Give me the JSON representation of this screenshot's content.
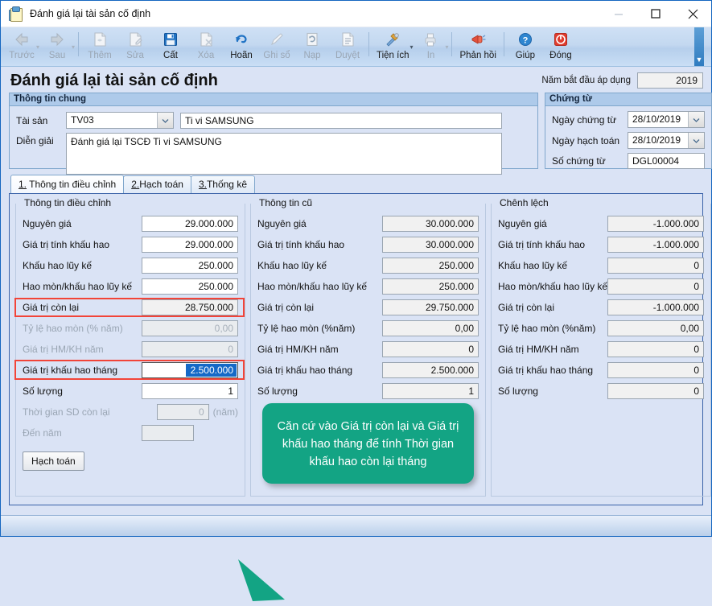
{
  "window": {
    "title": "Đánh giá lại tài sản cố định",
    "icon": "clipboard-icon",
    "minimize": "–",
    "maximize": "□",
    "close": "✕"
  },
  "toolbar": {
    "items": [
      {
        "label": "Trước",
        "icon": "arrow-left-icon",
        "disabled": true,
        "caret": true
      },
      {
        "label": "Sau",
        "icon": "arrow-right-icon",
        "disabled": true,
        "caret": true
      },
      {
        "label": "Thêm",
        "icon": "add-document-icon",
        "disabled": true,
        "caret": false
      },
      {
        "label": "Sửa",
        "icon": "edit-document-icon",
        "disabled": true,
        "caret": false
      },
      {
        "label": "Cất",
        "icon": "save-floppy-icon",
        "disabled": false,
        "caret": false
      },
      {
        "label": "Xóa",
        "icon": "delete-document-icon",
        "disabled": true,
        "caret": false
      },
      {
        "label": "Hoãn",
        "icon": "undo-arrow-icon",
        "disabled": false,
        "caret": false
      },
      {
        "label": "Ghi sổ",
        "icon": "pencil-icon",
        "disabled": true,
        "caret": false
      },
      {
        "label": "Nạp",
        "icon": "refresh-icon",
        "disabled": true,
        "caret": false
      },
      {
        "label": "Duyệt",
        "icon": "approve-list-icon",
        "disabled": true,
        "caret": false
      },
      {
        "label": "Tiện ích",
        "icon": "tools-icon",
        "disabled": false,
        "caret": true
      },
      {
        "label": "In",
        "icon": "printer-icon",
        "disabled": true,
        "caret": true
      },
      {
        "label": "Phản hồi",
        "icon": "megaphone-icon",
        "disabled": false,
        "caret": false
      },
      {
        "label": "Giúp",
        "icon": "help-question-icon",
        "disabled": false,
        "caret": false
      },
      {
        "label": "Đóng",
        "icon": "power-close-icon",
        "disabled": false,
        "caret": false
      }
    ]
  },
  "header": {
    "page_title": "Đánh giá lại tài sản cố định",
    "year_label": "Năm bắt đầu áp dụng",
    "year_value": "2019"
  },
  "general": {
    "title": "Thông tin chung",
    "asset_label": "Tài sản",
    "asset_code": "TV03",
    "asset_name": "Ti vi SAMSUNG",
    "note_label": "Diễn giải",
    "note_value": "Đánh giá lại TSCĐ Ti vi SAMSUNG"
  },
  "voucher": {
    "title": "Chứng từ",
    "rows": [
      {
        "label": "Ngày chứng từ",
        "value": "28/10/2019",
        "type": "date"
      },
      {
        "label": "Ngày hạch toán",
        "value": "28/10/2019",
        "type": "date"
      },
      {
        "label": "Số chứng từ",
        "value": "DGL00004",
        "type": "text"
      }
    ]
  },
  "tabs": [
    {
      "num": "1.",
      "label": " Thông tin điều chỉnh",
      "active": true
    },
    {
      "num": "2.",
      "label": "Hạch toán",
      "active": false
    },
    {
      "num": "3.",
      "label": "Thống kê",
      "active": false
    }
  ],
  "columns": {
    "adjusted": {
      "legend": "Thông tin điều chỉnh",
      "rows": [
        {
          "label": "Nguyên giá",
          "value": "29.000.000",
          "state": "edit"
        },
        {
          "label": "Giá trị tính khấu hao",
          "value": "29.000.000",
          "state": "edit"
        },
        {
          "label": "Khấu hao lũy kế",
          "value": "250.000",
          "state": "edit"
        },
        {
          "label": "Hao mòn/khấu hao lũy kế",
          "value": "250.000",
          "state": "edit"
        },
        {
          "label": "Giá trị còn lại",
          "value": "28.750.000",
          "state": "readonly",
          "highlight": true
        },
        {
          "label": "Tỷ lệ hao mòn (% năm)",
          "value": "0,00",
          "state": "disabled"
        },
        {
          "label": "Giá trị HM/KH năm",
          "value": "0",
          "state": "disabled"
        },
        {
          "label": "Giá trị khấu hao tháng",
          "value": "2.500.000",
          "state": "selected",
          "highlight": true
        },
        {
          "label": "Số lượng",
          "value": "1",
          "state": "edit"
        },
        {
          "label": "Thời gian SD còn lại",
          "value": "0",
          "state": "disabled",
          "unit": "(năm)"
        },
        {
          "label": "Đến năm",
          "value": "",
          "state": "disabled"
        }
      ],
      "button": "Hạch toán"
    },
    "old": {
      "legend": "Thông tin cũ",
      "rows": [
        {
          "label": "Nguyên giá",
          "value": "30.000.000"
        },
        {
          "label": "Giá trị tính khấu hao",
          "value": "30.000.000"
        },
        {
          "label": "Khấu hao lũy kế",
          "value": "250.000"
        },
        {
          "label": "Hao mòn/khấu hao lũy kế",
          "value": "250.000"
        },
        {
          "label": "Giá trị còn lại",
          "value": "29.750.000"
        },
        {
          "label": "Tỷ lệ hao mòn (%năm)",
          "value": "0,00"
        },
        {
          "label": "Giá trị HM/KH năm",
          "value": "0"
        },
        {
          "label": "Giá trị khấu hao tháng",
          "value": "2.500.000"
        },
        {
          "label": "Số lượng",
          "value": "1"
        }
      ]
    },
    "difference": {
      "legend": "Chênh lệch",
      "rows": [
        {
          "label": "Nguyên giá",
          "value": "-1.000.000"
        },
        {
          "label": "Giá trị tính khấu hao",
          "value": "-1.000.000"
        },
        {
          "label": "Khấu hao lũy kế",
          "value": "0"
        },
        {
          "label": "Hao mòn/khấu hao lũy kế",
          "value": "0"
        },
        {
          "label": "Giá trị còn lại",
          "value": "-1.000.000"
        },
        {
          "label": "Tỷ lệ hao mòn (%năm)",
          "value": "0,00"
        },
        {
          "label": "Giá trị HM/KH năm",
          "value": "0"
        },
        {
          "label": "Giá trị khấu hao tháng",
          "value": "0"
        },
        {
          "label": "Số lượng",
          "value": "0"
        }
      ]
    }
  },
  "callout": {
    "text": "Căn cứ vào Giá trị còn lại và Giá trị khấu hao tháng để tính Thời gian khấu hao còn lại tháng",
    "color": "#13a484"
  },
  "colors": {
    "background": "#dae3f5",
    "panel_header": "#aecaea",
    "border": "#7fa6cc",
    "highlight_red": "#f24438",
    "selection_blue": "#1569c7",
    "accent": "#13a484"
  }
}
